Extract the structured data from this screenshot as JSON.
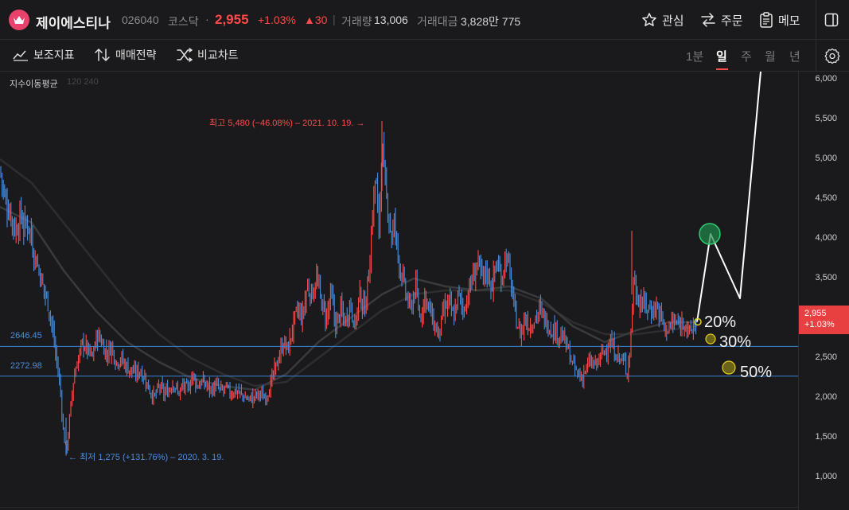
{
  "header": {
    "name": "제이에스티나",
    "code": "026040",
    "market": "코스닥",
    "dot": "·",
    "price": "2,955",
    "change_pct": "+1.03%",
    "change_abs": "▲30",
    "separator": "|",
    "volume_label": "거래량",
    "volume": "13,006",
    "amount_label": "거래대금",
    "amount": "3,828만 775",
    "actions": {
      "watch": "관심",
      "order": "주문",
      "memo": "메모"
    }
  },
  "toolbar": {
    "indicators": "보조지표",
    "strategy": "매매전략",
    "compare": "비교차트",
    "periods": [
      "1분",
      "일",
      "주",
      "월",
      "년"
    ],
    "active_period": "일"
  },
  "chart": {
    "ma_legend": "지수이동평균",
    "ma_periods": "120 240",
    "y_axis": [
      "6,000",
      "5,500",
      "5,000",
      "4,500",
      "4,000",
      "3,500",
      "2,500",
      "2,000",
      "1,500",
      "1,000"
    ],
    "price_tag": {
      "price": "2,955",
      "pct": "+1.03%"
    },
    "hlines": [
      "2646.45",
      "2272.98"
    ],
    "high_annotation": "최고 5,480 (−46.08%) – 2021. 10. 19.",
    "low_annotation": "최저 1,275 (+131.76%) – 2020. 3. 19.",
    "pct_marks": [
      "20%",
      "30%",
      "50%"
    ]
  },
  "chart_data": {
    "type": "candlestick",
    "y_range": [
      750,
      6100
    ],
    "current_price": 2955,
    "horizontal_lines": [
      2646.45,
      2272.98
    ],
    "all_time_high": {
      "value": 5480,
      "date": "2021. 10. 19."
    },
    "all_time_low": {
      "value": 1275,
      "date": "2020. 3. 19."
    },
    "moving_averages": [
      "120",
      "240"
    ],
    "colors": {
      "up": "#ff4a4a",
      "down": "#4a8fe0",
      "hline": "#3b82d6",
      "target": "#2ecc71",
      "fib": "#e6d21a"
    },
    "close_path": [
      [
        0,
        4880
      ],
      [
        6,
        4500
      ],
      [
        12,
        4350
      ],
      [
        20,
        4100
      ],
      [
        26,
        4300
      ],
      [
        30,
        4150
      ],
      [
        36,
        4200
      ],
      [
        42,
        3850
      ],
      [
        48,
        3650
      ],
      [
        54,
        3400
      ],
      [
        60,
        3200
      ],
      [
        64,
        3000
      ],
      [
        68,
        2700
      ],
      [
        72,
        2400
      ],
      [
        76,
        2100
      ],
      [
        80,
        1500
      ],
      [
        84,
        1350
      ],
      [
        88,
        1800
      ],
      [
        92,
        2200
      ],
      [
        96,
        2400
      ],
      [
        100,
        2550
      ],
      [
        104,
        2700
      ],
      [
        110,
        2600
      ],
      [
        116,
        2500
      ],
      [
        122,
        2800
      ],
      [
        128,
        2700
      ],
      [
        134,
        2550
      ],
      [
        140,
        2650
      ],
      [
        146,
        2450
      ],
      [
        152,
        2500
      ],
      [
        158,
        2400
      ],
      [
        164,
        2350
      ],
      [
        170,
        2300
      ],
      [
        176,
        2350
      ],
      [
        182,
        2250
      ],
      [
        188,
        2100
      ],
      [
        194,
        2000
      ],
      [
        200,
        2150
      ],
      [
        206,
        2050
      ],
      [
        212,
        2100
      ],
      [
        218,
        2200
      ],
      [
        224,
        2050
      ],
      [
        230,
        2150
      ],
      [
        236,
        2100
      ],
      [
        242,
        2300
      ],
      [
        248,
        2150
      ],
      [
        254,
        2200
      ],
      [
        260,
        2150
      ],
      [
        266,
        2100
      ],
      [
        272,
        2150
      ],
      [
        278,
        2080
      ],
      [
        284,
        2120
      ],
      [
        290,
        2050
      ],
      [
        296,
        2100
      ],
      [
        302,
        2050
      ],
      [
        308,
        2000
      ],
      [
        314,
        1980
      ],
      [
        320,
        2020
      ],
      [
        326,
        2050
      ],
      [
        332,
        2000
      ],
      [
        338,
        2100
      ],
      [
        344,
        2300
      ],
      [
        350,
        2500
      ],
      [
        356,
        2700
      ],
      [
        362,
        2600
      ],
      [
        368,
        2900
      ],
      [
        374,
        3100
      ],
      [
        380,
        3000
      ],
      [
        386,
        3400
      ],
      [
        392,
        3300
      ],
      [
        398,
        3500
      ],
      [
        404,
        3200
      ],
      [
        410,
        3000
      ],
      [
        416,
        3300
      ],
      [
        422,
        2900
      ],
      [
        428,
        3100
      ],
      [
        434,
        2950
      ],
      [
        440,
        3200
      ],
      [
        446,
        2900
      ],
      [
        452,
        3300
      ],
      [
        458,
        3100
      ],
      [
        464,
        3600
      ],
      [
        468,
        4300
      ],
      [
        472,
        4800
      ],
      [
        476,
        4100
      ],
      [
        480,
        5200
      ],
      [
        484,
        4600
      ],
      [
        488,
        4400
      ],
      [
        492,
        4000
      ],
      [
        496,
        4200
      ],
      [
        500,
        3800
      ],
      [
        506,
        3500
      ],
      [
        510,
        3300
      ],
      [
        516,
        3100
      ],
      [
        522,
        3400
      ],
      [
        528,
        3000
      ],
      [
        534,
        3300
      ],
      [
        540,
        3100
      ],
      [
        546,
        2900
      ],
      [
        552,
        2800
      ],
      [
        558,
        3100
      ],
      [
        564,
        3200
      ],
      [
        570,
        3000
      ],
      [
        576,
        3300
      ],
      [
        582,
        3100
      ],
      [
        588,
        3300
      ],
      [
        594,
        3500
      ],
      [
        600,
        3700
      ],
      [
        606,
        3500
      ],
      [
        612,
        3600
      ],
      [
        618,
        3400
      ],
      [
        624,
        3700
      ],
      [
        630,
        3500
      ],
      [
        636,
        3800
      ],
      [
        640,
        3600
      ],
      [
        644,
        3300
      ],
      [
        648,
        3000
      ],
      [
        654,
        2800
      ],
      [
        660,
        3000
      ],
      [
        666,
        2900
      ],
      [
        672,
        3000
      ],
      [
        678,
        3100
      ],
      [
        684,
        3000
      ],
      [
        690,
        2900
      ],
      [
        696,
        2850
      ],
      [
        702,
        2800
      ],
      [
        708,
        2750
      ],
      [
        714,
        2600
      ],
      [
        720,
        2400
      ],
      [
        726,
        2300
      ],
      [
        730,
        2250
      ],
      [
        736,
        2350
      ],
      [
        742,
        2450
      ],
      [
        748,
        2400
      ],
      [
        754,
        2500
      ],
      [
        760,
        2600
      ],
      [
        766,
        2700
      ],
      [
        772,
        2600
      ],
      [
        778,
        2500
      ],
      [
        784,
        2450
      ],
      [
        788,
        2350
      ],
      [
        792,
        2600
      ],
      [
        796,
        3500
      ],
      [
        800,
        3300
      ],
      [
        806,
        3200
      ],
      [
        812,
        3150
      ],
      [
        818,
        3100
      ],
      [
        824,
        3150
      ],
      [
        830,
        3050
      ],
      [
        836,
        2850
      ],
      [
        842,
        2900
      ],
      [
        848,
        2950
      ],
      [
        854,
        2900
      ],
      [
        860,
        3000
      ],
      [
        866,
        2800
      ],
      [
        872,
        2900
      ],
      [
        876,
        2955
      ]
    ],
    "ma120_path": [
      [
        0,
        4400
      ],
      [
        40,
        4200
      ],
      [
        80,
        3600
      ],
      [
        120,
        3100
      ],
      [
        160,
        2700
      ],
      [
        200,
        2450
      ],
      [
        240,
        2250
      ],
      [
        280,
        2150
      ],
      [
        320,
        2100
      ],
      [
        360,
        2300
      ],
      [
        400,
        2700
      ],
      [
        440,
        3000
      ],
      [
        480,
        3300
      ],
      [
        520,
        3500
      ],
      [
        560,
        3400
      ],
      [
        600,
        3350
      ],
      [
        640,
        3400
      ],
      [
        680,
        3250
      ],
      [
        720,
        2900
      ],
      [
        760,
        2700
      ],
      [
        800,
        2850
      ],
      [
        840,
        2950
      ],
      [
        876,
        2950
      ]
    ],
    "ma240_path": [
      [
        0,
        5000
      ],
      [
        40,
        4700
      ],
      [
        80,
        4200
      ],
      [
        120,
        3700
      ],
      [
        160,
        3200
      ],
      [
        200,
        2800
      ],
      [
        240,
        2500
      ],
      [
        280,
        2300
      ],
      [
        320,
        2150
      ],
      [
        360,
        2200
      ],
      [
        400,
        2500
      ],
      [
        440,
        2800
      ],
      [
        480,
        3100
      ],
      [
        520,
        3300
      ],
      [
        560,
        3350
      ],
      [
        600,
        3350
      ],
      [
        640,
        3350
      ],
      [
        680,
        3200
      ],
      [
        720,
        2950
      ],
      [
        760,
        2800
      ],
      [
        800,
        2800
      ],
      [
        840,
        2850
      ],
      [
        876,
        2900
      ]
    ],
    "projection_path": [
      [
        876,
        2955
      ],
      [
        893,
        4060
      ],
      [
        930,
        3250
      ],
      [
        956,
        6100
      ]
    ],
    "target_marker": 4060,
    "fib_marks": [
      {
        "label": "20%",
        "x": 877,
        "value": 2955
      },
      {
        "label": "30%",
        "x": 893,
        "value": 2740
      },
      {
        "label": "50%",
        "x": 916,
        "value": 2380
      }
    ]
  }
}
